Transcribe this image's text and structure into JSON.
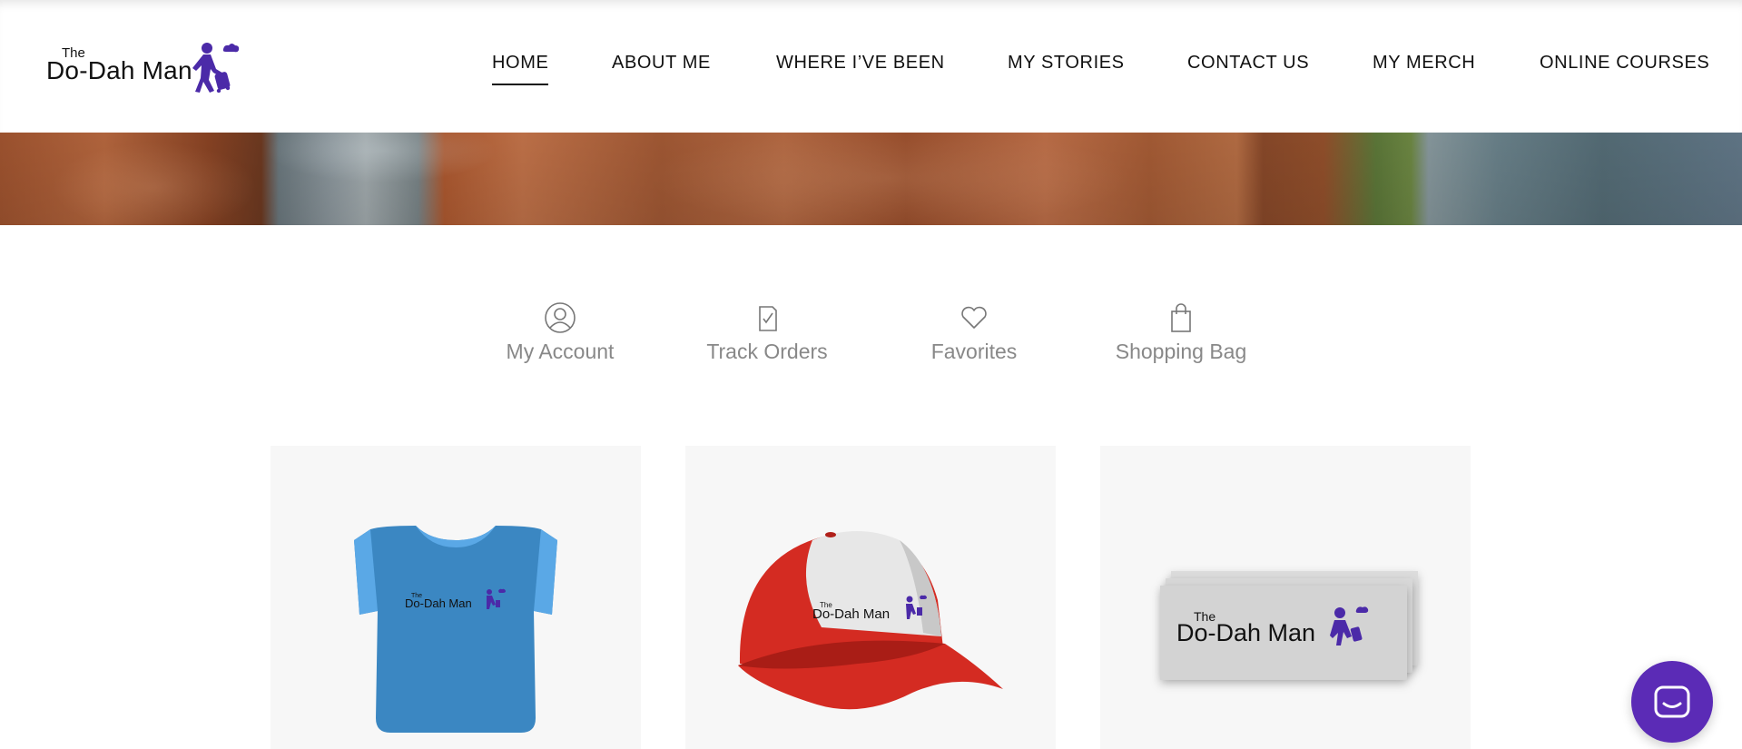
{
  "brand": {
    "logo_small": "The",
    "logo_main": "Do-Dah Man",
    "accent": "#4b2aa8"
  },
  "nav": {
    "items": [
      {
        "label": "HOME",
        "active": true
      },
      {
        "label": "ABOUT ME",
        "active": false
      },
      {
        "label": "WHERE I’VE BEEN",
        "active": false
      },
      {
        "label": "MY STORIES",
        "active": false
      },
      {
        "label": "CONTACT US",
        "active": false
      },
      {
        "label": "MY MERCH",
        "active": false
      },
      {
        "label": "ONLINE COURSES",
        "active": false
      }
    ]
  },
  "account_links": [
    {
      "label": "My Account",
      "icon": "user-icon"
    },
    {
      "label": "Track Orders",
      "icon": "clipboard-check-icon"
    },
    {
      "label": "Favorites",
      "icon": "heart-icon"
    },
    {
      "label": "Shopping Bag",
      "icon": "shopping-bag-icon"
    }
  ],
  "products": [
    {
      "name": "t-shirt",
      "color": "#3b87c2",
      "logo_small": "The",
      "logo_main": "Do-Dah Man"
    },
    {
      "name": "cap",
      "color": "#d42b22",
      "logo_small": "The",
      "logo_main": "Do-Dah Man"
    },
    {
      "name": "sticker",
      "color": "#d6d6d6",
      "logo_small": "The",
      "logo_main": "Do-Dah Man"
    }
  ],
  "chat": {
    "icon": "chat-icon",
    "color": "#5b2bb6"
  }
}
